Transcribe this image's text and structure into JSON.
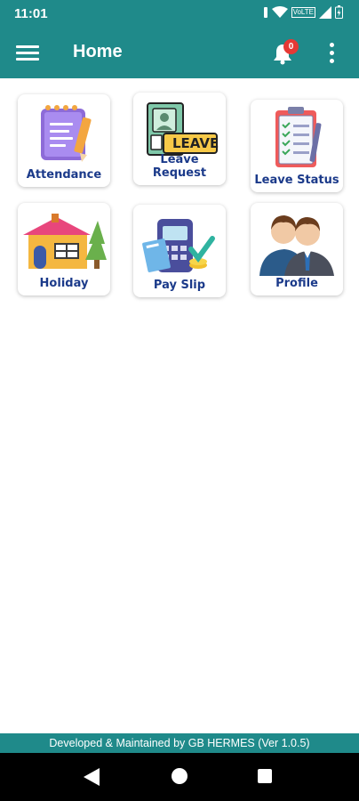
{
  "status": {
    "time": "11:01",
    "network": "VoLTE"
  },
  "app_bar": {
    "title": "Home",
    "notification_count": "0"
  },
  "menu_items": [
    {
      "label": "Attendance"
    },
    {
      "label": "Leave Request",
      "art_text": "LEAVE"
    },
    {
      "label": "Leave Status"
    },
    {
      "label": "Holiday"
    },
    {
      "label": "Pay Slip"
    },
    {
      "label": "Profile"
    }
  ],
  "footer": {
    "text": "Developed & Maintained by GB HERMES (Ver 1.0.5)"
  },
  "colors": {
    "primary": "#1f8a8a",
    "label": "#1b3a8a",
    "badge": "#e53935"
  }
}
